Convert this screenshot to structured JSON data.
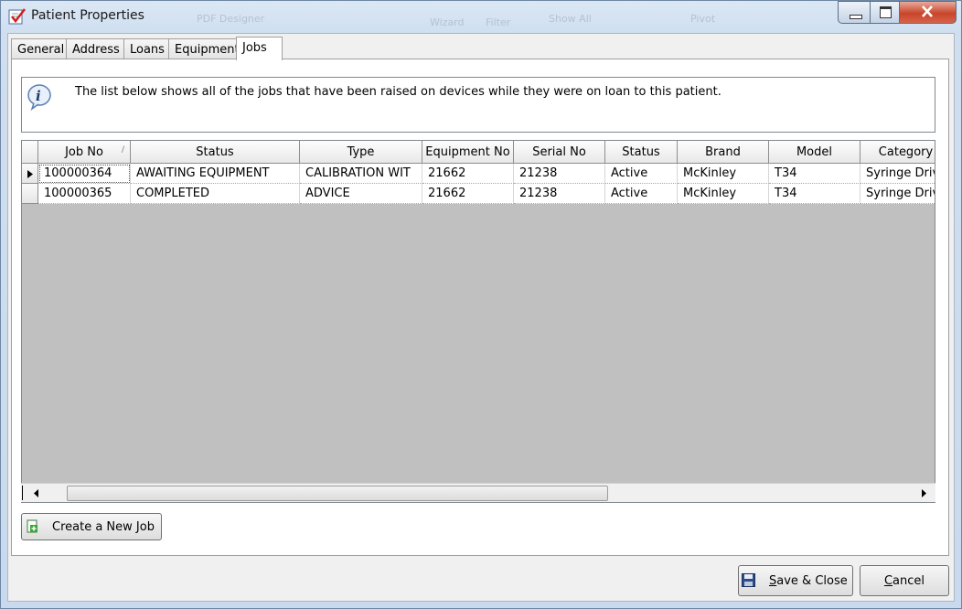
{
  "window": {
    "title": "Patient Properties"
  },
  "background_ribbon": {
    "items": [
      "PDF Designer",
      "Show All",
      "Pivot",
      "Wizard",
      "Filter"
    ]
  },
  "tabs": [
    {
      "label": "General"
    },
    {
      "label": "Address"
    },
    {
      "label": "Loans"
    },
    {
      "label": "Equipment"
    },
    {
      "label": "Jobs",
      "active": true
    }
  ],
  "info": {
    "text": "The list below shows all of the jobs that have been raised on devices while they were on loan to this patient."
  },
  "grid": {
    "columns": [
      "Job No",
      "Status",
      "Type",
      "Equipment No",
      "Serial No",
      "Status",
      "Brand",
      "Model",
      "Category"
    ],
    "rows": [
      {
        "job_no": "100000364",
        "status": "AWAITING EQUIPMENT",
        "type": "CALIBRATION WIT",
        "equipment_no": "21662",
        "serial_no": "21238",
        "equip_status": "Active",
        "brand": "McKinley",
        "model": "T34",
        "category": "Syringe Driver",
        "current": true
      },
      {
        "job_no": "100000365",
        "status": "COMPLETED",
        "type": "ADVICE",
        "equipment_no": "21662",
        "serial_no": "21238",
        "equip_status": "Active",
        "brand": "McKinley",
        "model": "T34",
        "category": "Syringe Driver",
        "current": false
      }
    ],
    "sorted_column": "Job No"
  },
  "buttons": {
    "create_job": "Create a New Job",
    "save_close_pre": "",
    "save_close_ul": "S",
    "save_close_post": "ave & Close",
    "cancel_ul": "C",
    "cancel_post": "ancel"
  },
  "colors": {
    "grid_empty": "#c0c0c0",
    "close_button": "#c8462b",
    "frame": "#cfdff0"
  }
}
